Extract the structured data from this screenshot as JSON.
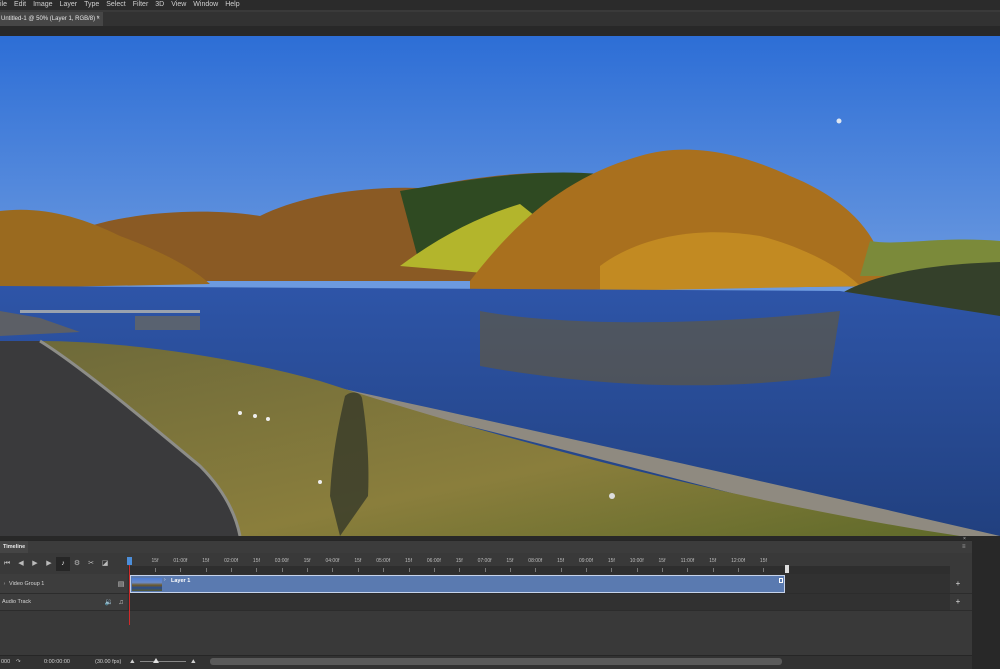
{
  "menu": [
    "ile",
    "Edit",
    "Image",
    "Layer",
    "Type",
    "Select",
    "Filter",
    "3D",
    "View",
    "Window",
    "Help"
  ],
  "document_tab": {
    "title": "Untitled-1 @ 50% (Layer 1, RGB/8) *",
    "close": "×"
  },
  "timeline": {
    "tab_label": "Timeline",
    "panel_menu": "≡",
    "close": "×",
    "controls": [
      {
        "name": "go-to-first-frame-icon",
        "glyph": "⏮"
      },
      {
        "name": "previous-frame-icon",
        "glyph": "◀"
      },
      {
        "name": "play-icon",
        "glyph": "▶"
      },
      {
        "name": "next-frame-icon",
        "glyph": "▶▶"
      },
      {
        "name": "audio-icon",
        "glyph": "🔊"
      },
      {
        "name": "settings-gear-icon",
        "glyph": "⚙"
      },
      {
        "name": "split-scissors-icon",
        "glyph": "✂"
      },
      {
        "name": "transition-icon",
        "glyph": "◪"
      }
    ],
    "ruler_ticks": [
      "15f",
      "01:00f",
      "15f",
      "02:00f",
      "15f",
      "03:00f",
      "15f",
      "04:00f",
      "15f",
      "05:00f",
      "15f",
      "06:00f",
      "15f",
      "07:00f",
      "15f",
      "08:00f",
      "15f",
      "09:00f",
      "15f",
      "10:00f",
      "15f",
      "11:00f",
      "15f",
      "12:00f",
      "15f"
    ],
    "tracks": {
      "video": {
        "label": "Video Group 1",
        "expand": "›",
        "clip_name": "Layer 1",
        "clip_arrow": "›",
        "add": "+"
      },
      "audio": {
        "label": "Audio Track",
        "add": "+"
      }
    },
    "status": {
      "render_label": "000",
      "timecode": "0:00:00:00",
      "fps": "(30.00 fps)"
    }
  }
}
